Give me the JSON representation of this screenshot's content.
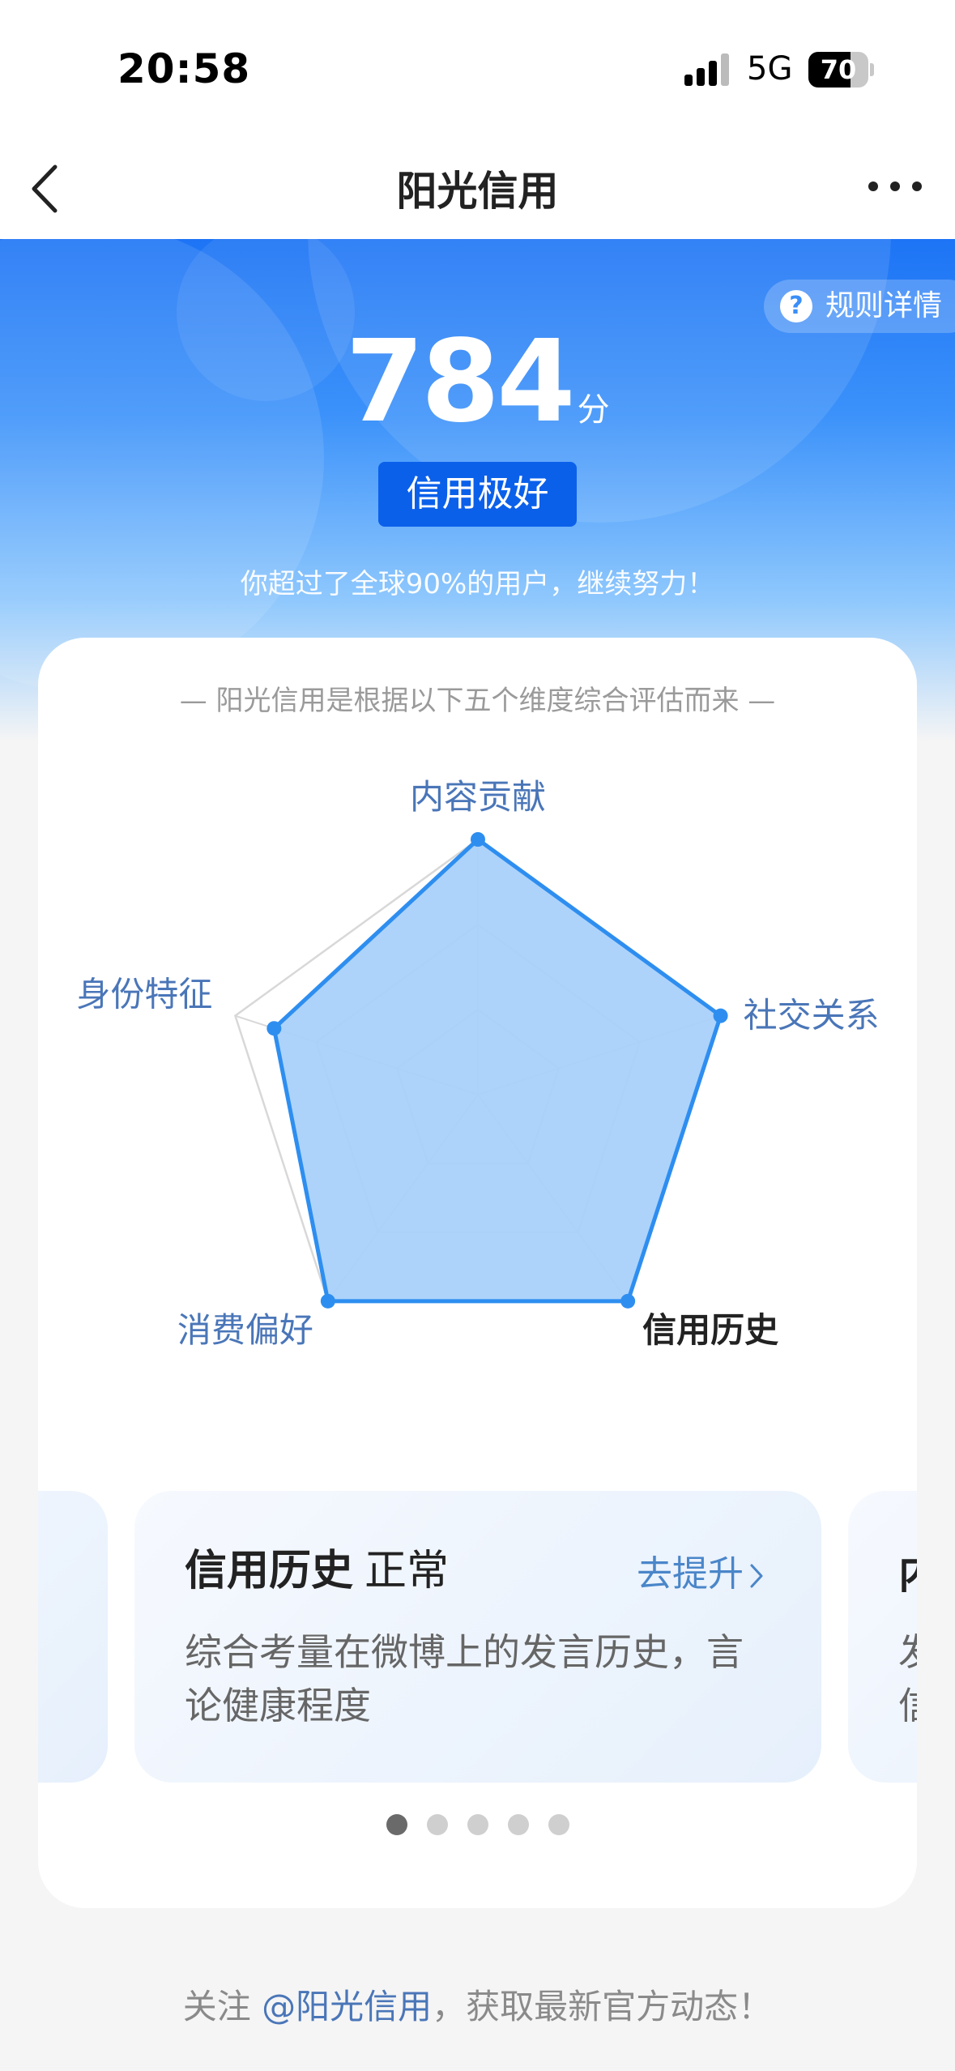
{
  "status_bar": {
    "time": "20:58",
    "network": "5G",
    "battery": 70
  },
  "nav": {
    "title": "阳光信用",
    "back_icon": "chevron-left-icon",
    "more_icon": "ellipsis-icon"
  },
  "hero": {
    "rules_label": "规则详情",
    "rules_icon": "question-circle-icon",
    "score": "784",
    "score_unit": "分",
    "level": "信用极好",
    "percentile_text": "你超过了全球90%的用户，继续努力！"
  },
  "card": {
    "intro": "— 阳光信用是根据以下五个维度综合评估而来 —",
    "dimensions": [
      {
        "label": "内容贡献",
        "value": 1.0,
        "selected": false
      },
      {
        "label": "社交关系",
        "value": 1.0,
        "selected": false
      },
      {
        "label": "信用历史",
        "value": 1.0,
        "selected": true
      },
      {
        "label": "消费偏好",
        "value": 1.0,
        "selected": false
      },
      {
        "label": "身份特征",
        "value": 0.84,
        "selected": false
      }
    ],
    "colors": {
      "fill": "#a9d1fb",
      "stroke": "#2e8ef0",
      "label": "#4a76b8",
      "label_selected": "#222222",
      "grid": "#d8d8d8"
    },
    "slide": {
      "name": "信用历史",
      "status": "正常",
      "action": "去提升",
      "description": "综合考量在微博上的发言历史，言论健康程度"
    },
    "next_slide_peek": {
      "title_char": "内",
      "desc_char_1": "发",
      "desc_char_2": "信"
    },
    "pager": {
      "count": 5,
      "active": 1
    }
  },
  "footer": {
    "prefix": "关注 ",
    "link": "@阳光信用",
    "suffix": "，获取最新官方动态！"
  }
}
